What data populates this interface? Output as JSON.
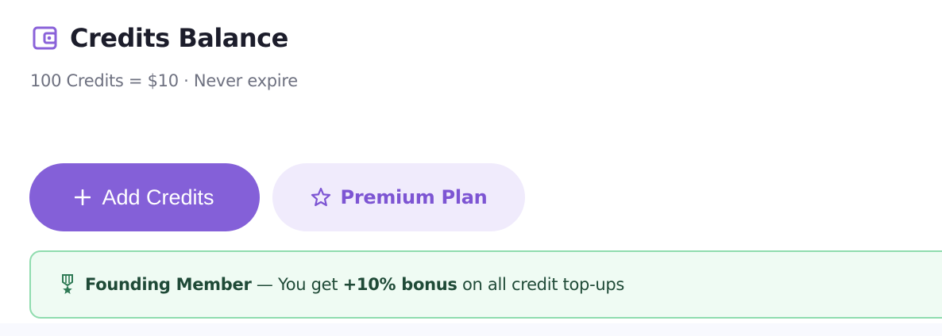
{
  "header": {
    "title": "Credits Balance",
    "subtitle": "100 Credits = $10 · Never expire",
    "icon": "wallet-icon"
  },
  "actions": {
    "add_credits": {
      "label": "Add Credits",
      "icon": "plus-icon"
    },
    "premium_plan": {
      "label": "Premium Plan",
      "icon": "star-icon"
    }
  },
  "banner": {
    "icon": "medal-icon",
    "strong_label": "Founding Member",
    "text_middle": " — You get ",
    "bonus": "+10% bonus",
    "text_end": " on all credit top-ups"
  },
  "colors": {
    "accent": "#8460d8",
    "accent_light": "#f0ebfc",
    "success_border": "#8fdcae",
    "success_bg": "#effbf3",
    "success_text": "#1f4a37"
  }
}
